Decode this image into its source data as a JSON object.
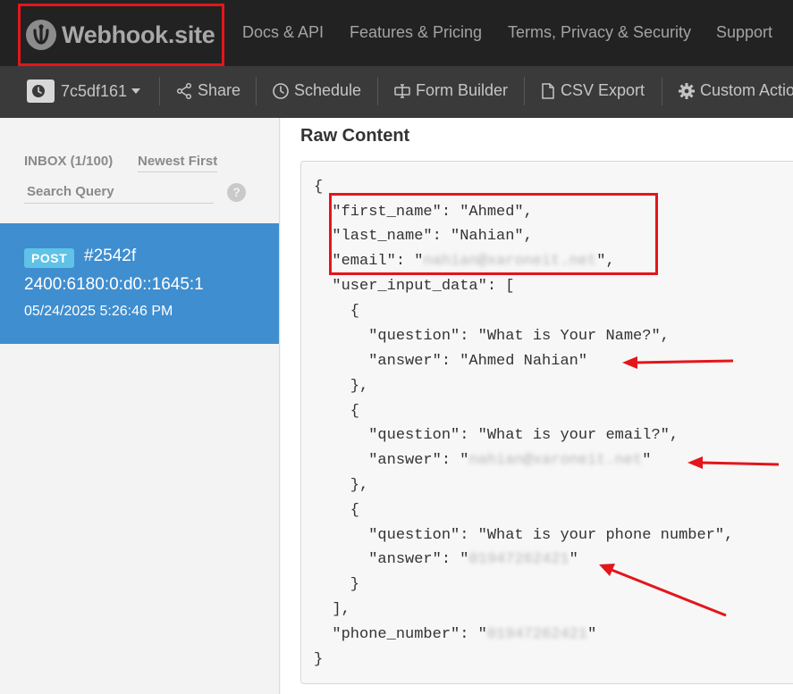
{
  "header": {
    "brand": "Webhook.site",
    "nav": [
      "Docs & API",
      "Features & Pricing",
      "Terms, Privacy & Security",
      "Support"
    ]
  },
  "toolbar": {
    "token": "7c5df161",
    "share": "Share",
    "schedule": "Schedule",
    "form_builder": "Form Builder",
    "csv_export": "CSV Export",
    "custom_actions": "Custom Actions"
  },
  "sidebar": {
    "inbox": "INBOX (1/100)",
    "sort": "Newest First",
    "search_placeholder": "Search Query",
    "help": "?",
    "request": {
      "method": "POST",
      "id": "#2542f",
      "ip": "2400:6180:0:d0::1645:1",
      "time": "05/24/2025 5:26:46 PM"
    }
  },
  "main": {
    "title": "Raw Content",
    "json_lines": [
      "{",
      "  \"first_name\": \"Ahmed\",",
      "  \"last_name\": \"Nahian\",",
      "  \"email\": \"",
      "  \"user_input_data\": [",
      "    {",
      "      \"question\": \"What is Your Name?\",",
      "      \"answer\": \"Ahmed Nahian\"",
      "    },",
      "    {",
      "      \"question\": \"What is your email?\",",
      "      \"answer\": \"",
      "    },",
      "    {",
      "      \"question\": \"What is your phone number\",",
      "      \"answer\": \"",
      "    }",
      "  ],",
      "  \"phone_number\": \"",
      "}"
    ],
    "redacted": {
      "email": "nahian@xaroneit.net",
      "answer_email": "nahian@xaroneit.net",
      "phone": "01947262421",
      "phone_number": "01947262421"
    },
    "line_suffix": {
      "email": "\",",
      "answer_email": "\"",
      "phone": "\"",
      "phone_number": "\""
    }
  },
  "colors": {
    "annotation": "#e3161b",
    "selected_request": "#3f8ed0",
    "method_badge": "#5fc2e6"
  }
}
